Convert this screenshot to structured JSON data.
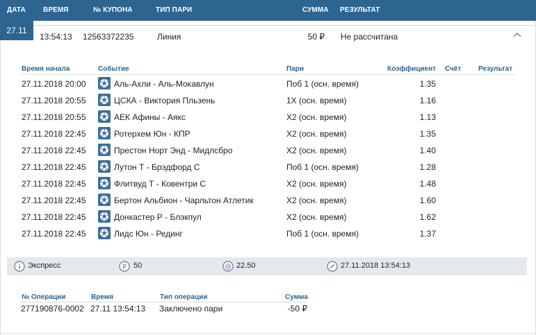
{
  "header": {
    "date": "Дата",
    "time": "Время",
    "coupon": "№ Купона",
    "bet_type": "Тип пари",
    "amount": "Сумма",
    "result": "Результат"
  },
  "bet": {
    "date": "27.11",
    "time": "13:54:13",
    "coupon": "12563372235",
    "type": "Линия",
    "amount": "50 ₽",
    "result": "Не рассчитана"
  },
  "events_header": {
    "start_time": "Время начала",
    "event": "Событие",
    "bet": "Пари",
    "coefficient": "Коэффициент",
    "score": "Счёт",
    "result": "Результат"
  },
  "events": [
    {
      "time": "27.11.2018 20:00",
      "event": "Аль-Ахли - Аль-Мокавлун",
      "bet": "Поб 1 (осн. время)",
      "coef": "1.35",
      "icon": "football-icon"
    },
    {
      "time": "27.11.2018 20:55",
      "event": "ЦСКА - Виктория Пльзень",
      "bet": "1X (осн. время)",
      "coef": "1.16",
      "icon": "football-icon"
    },
    {
      "time": "27.11.2018 20:55",
      "event": "АЕК Афины - Аякс",
      "bet": "X2 (осн. время)",
      "coef": "1.13",
      "icon": "football-icon"
    },
    {
      "time": "27.11.2018 22:45",
      "event": "Ротерхем Юн - КПР",
      "bet": "X2 (осн. время)",
      "coef": "1.35",
      "icon": "football-icon"
    },
    {
      "time": "27.11.2018 22:45",
      "event": "Престон Норт Энд - Мидлсбро",
      "bet": "X2 (осн. время)",
      "coef": "1.40",
      "icon": "football-icon"
    },
    {
      "time": "27.11.2018 22:45",
      "event": "Лутон Т - Брэдфорд С",
      "bet": "Поб 1 (осн. время)",
      "coef": "1.28",
      "icon": "football-icon"
    },
    {
      "time": "27.11.2018 22:45",
      "event": "Флитвуд Т - Ковентри С",
      "bet": "X2 (осн. время)",
      "coef": "1.48",
      "icon": "football-icon"
    },
    {
      "time": "27.11.2018 22:45",
      "event": "Бертон Альбион - Чарльтон Атлетик",
      "bet": "X2 (осн. время)",
      "coef": "1.60",
      "icon": "football-icon"
    },
    {
      "time": "27.11.2018 22:45",
      "event": "Донкастер Р - Блэкпул",
      "bet": "X2 (осн. время)",
      "coef": "1.62",
      "icon": "football-icon"
    },
    {
      "time": "27.11.2018 22:45",
      "event": "Лидс Юн - Рединг",
      "bet": "Поб 1 (осн. время)",
      "coef": "1.37",
      "icon": "football-icon"
    }
  ],
  "summary": {
    "type": "Экспресс",
    "stake": "50",
    "total_coef": "22.50",
    "datetime": "27.11.2018 13:54:13"
  },
  "operations_header": {
    "op_number": "№ Операции",
    "time": "Время",
    "op_type": "Тип операции",
    "amount": "Сумма"
  },
  "operations": [
    {
      "op_number": "277190876-0002",
      "time": "27.11 13:54:13",
      "op_type": "Заключено пари",
      "amount": "-50 ₽"
    }
  ],
  "colors": {
    "header_bg": "#2d6591",
    "label_blue": "#2d6591",
    "summary_bg": "#e6e9ec",
    "icon_blue": "#3f6f97"
  }
}
